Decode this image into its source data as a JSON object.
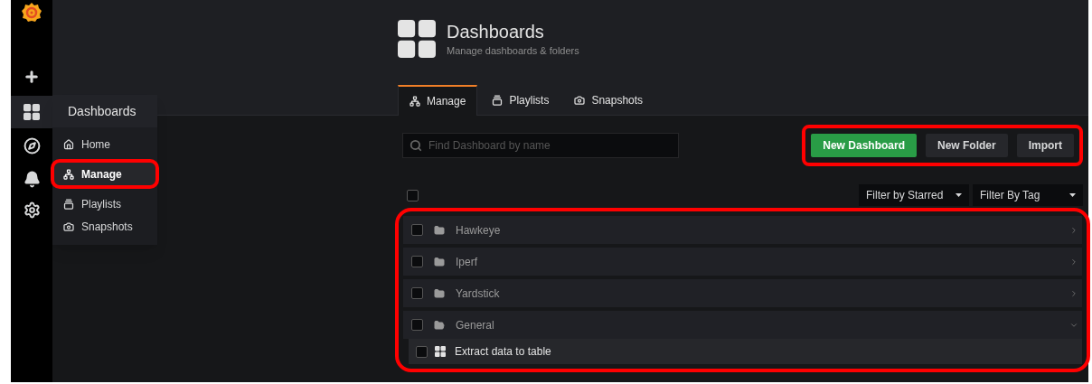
{
  "sidemenu": {
    "flyout": {
      "title": "Dashboards",
      "items": [
        {
          "label": "Home",
          "selected": false,
          "highlighted": false
        },
        {
          "label": "Manage",
          "selected": true,
          "highlighted": true
        },
        {
          "label": "Playlists",
          "selected": false,
          "highlighted": false
        },
        {
          "label": "Snapshots",
          "selected": false,
          "highlighted": false
        }
      ]
    }
  },
  "page_header": {
    "title": "Dashboards",
    "subtitle": "Manage dashboards & folders"
  },
  "tabs": [
    {
      "label": "Manage",
      "selected": true
    },
    {
      "label": "Playlists",
      "selected": false
    },
    {
      "label": "Snapshots",
      "selected": false
    }
  ],
  "search": {
    "placeholder": "Find Dashboard by name"
  },
  "actions": {
    "highlighted": true,
    "buttons": [
      {
        "label": "New Dashboard",
        "kind": "primary"
      },
      {
        "label": "New Folder",
        "kind": "secondary"
      },
      {
        "label": "Import",
        "kind": "secondary"
      }
    ]
  },
  "filters": [
    {
      "label": "Filter by Starred"
    },
    {
      "label": "Filter By Tag"
    }
  ],
  "list": {
    "highlighted": true,
    "select_all": {
      "checked": false
    },
    "items": [
      {
        "kind": "folder",
        "label": "Hawkeye",
        "checked": false,
        "expanded": false
      },
      {
        "kind": "folder",
        "label": "Iperf",
        "checked": false,
        "expanded": false
      },
      {
        "kind": "folder",
        "label": "Yardstick",
        "checked": false,
        "expanded": false
      },
      {
        "kind": "folder",
        "label": "General",
        "checked": false,
        "expanded": true
      },
      {
        "kind": "dashboard",
        "label": "Extract data to table",
        "checked": false
      }
    ]
  }
}
